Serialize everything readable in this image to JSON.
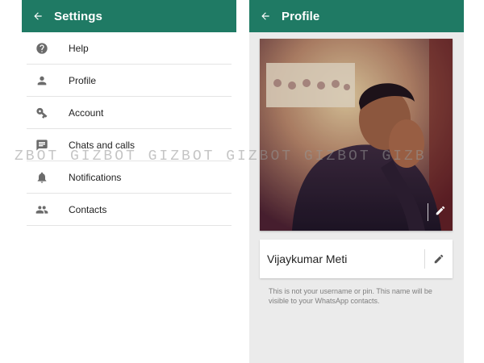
{
  "settings_screen": {
    "title": "Settings",
    "items": [
      {
        "label": "Help",
        "icon": "help-icon"
      },
      {
        "label": "Profile",
        "icon": "person-icon"
      },
      {
        "label": "Account",
        "icon": "key-icon"
      },
      {
        "label": "Chats and calls",
        "icon": "chat-icon"
      },
      {
        "label": "Notifications",
        "icon": "bell-icon"
      },
      {
        "label": "Contacts",
        "icon": "people-icon"
      }
    ]
  },
  "profile_screen": {
    "title": "Profile",
    "name": "Vijaykumar Meti",
    "hint": "This is not your username or pin. This name will be visible to your WhatsApp contacts."
  },
  "watermark": "ZBOT GIZBOT GIZBOT GIZBOT GIZBOT GIZB",
  "colors": {
    "appbar": "#1f7a64",
    "icon": "#6b6b6b",
    "profile_background": "#ebebeb"
  }
}
